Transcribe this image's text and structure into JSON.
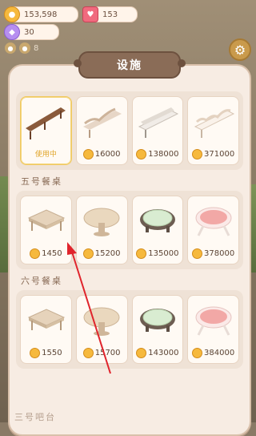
{
  "currencies": {
    "coins": "153,598",
    "hearts": "153",
    "gems": "30",
    "sub_value": "8"
  },
  "icons": {
    "coins": "coin-icon",
    "hearts": "heart-icon",
    "gems": "gem-icon",
    "settings": "gear-icon"
  },
  "panel": {
    "title": "设施"
  },
  "sections": [
    {
      "label": "",
      "items": [
        {
          "kind": "bench-wood",
          "status": "使用中",
          "price": ""
        },
        {
          "kind": "bench-carved",
          "status": "",
          "price": "16000"
        },
        {
          "kind": "bench-white",
          "status": "",
          "price": "138000"
        },
        {
          "kind": "bench-lace",
          "status": "",
          "price": "371000"
        }
      ]
    },
    {
      "label": "五号餐桌",
      "items": [
        {
          "kind": "table-square",
          "price": "1450"
        },
        {
          "kind": "table-round",
          "price": "15200"
        },
        {
          "kind": "table-mat",
          "price": "135000"
        },
        {
          "kind": "table-pink",
          "price": "378000"
        }
      ]
    },
    {
      "label": "六号餐桌",
      "items": [
        {
          "kind": "table-square",
          "price": "1550"
        },
        {
          "kind": "table-round",
          "price": "15700"
        },
        {
          "kind": "table-mat",
          "price": "143000"
        },
        {
          "kind": "table-pink",
          "price": "384000"
        }
      ]
    }
  ],
  "next_section_peek": "三号吧台"
}
